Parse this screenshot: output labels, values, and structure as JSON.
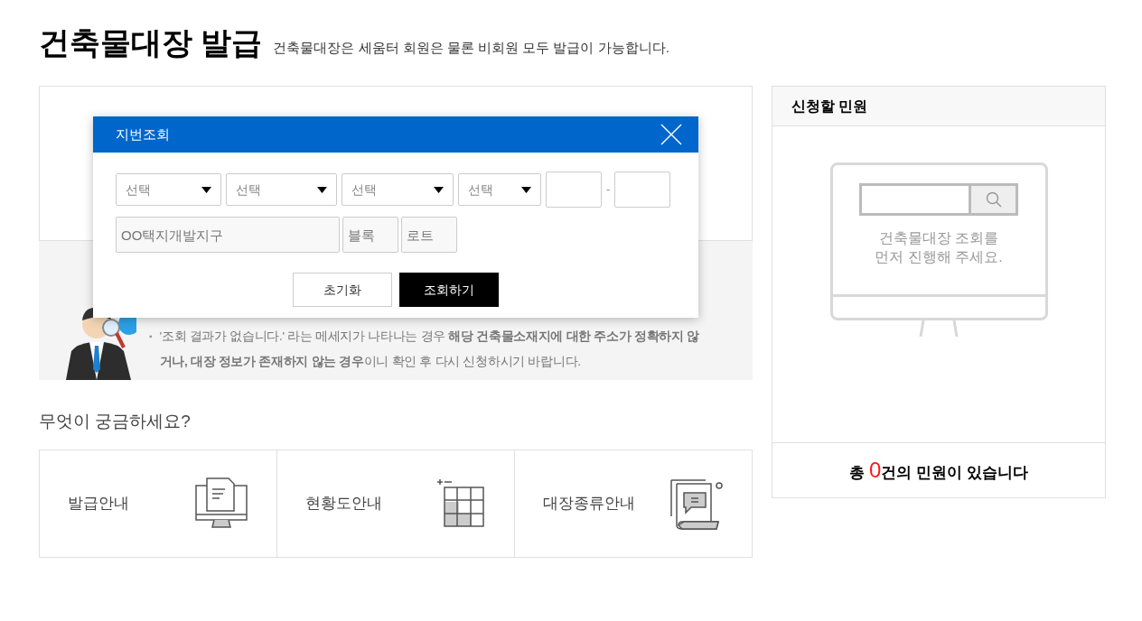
{
  "page": {
    "title": "건축물대장 발급",
    "subtitle": "건축물대장은 세움터 회원은 물론 비회원 모두 발급이 가능합니다."
  },
  "notice": {
    "bullet": "▪",
    "text": "'조회 결과가 없습니다.' 라는 메세지가 나타나는 경우 **해당 건축물소재지에 대한 주소가 정확하지 않거나, 대장 정보가 존재하지 않는 경우**이니 확인 후 다시 신청하시기 바랍니다."
  },
  "dialog": {
    "title": "지번조회",
    "selects": [
      {
        "placeholder": "선택"
      },
      {
        "placeholder": "선택"
      },
      {
        "placeholder": "선택"
      },
      {
        "placeholder": "선택"
      }
    ],
    "separator": "-",
    "fields": [
      {
        "placeholder": "OO택지개발지구"
      },
      {
        "placeholder": "블록"
      },
      {
        "placeholder": "로트"
      }
    ],
    "buttons": [
      {
        "label": "초기화",
        "kind": "secondary"
      },
      {
        "label": "조회하기",
        "kind": "primary"
      }
    ]
  },
  "faq": {
    "heading": "무엇이 궁금하세요?",
    "cards": [
      {
        "label": "발급안내",
        "kind": "monitor"
      },
      {
        "label": "현황도안내",
        "kind": "grid"
      },
      {
        "label": "대장종류안내",
        "kind": "scroll"
      }
    ]
  },
  "cart": {
    "title": "신청할 민원",
    "message_lines": [
      "건축물대장 조회를",
      "먼저 진행해 주세요."
    ],
    "total_prefix": "총 ",
    "count": "0",
    "total_suffix": "건의 민원이 있습니다"
  }
}
